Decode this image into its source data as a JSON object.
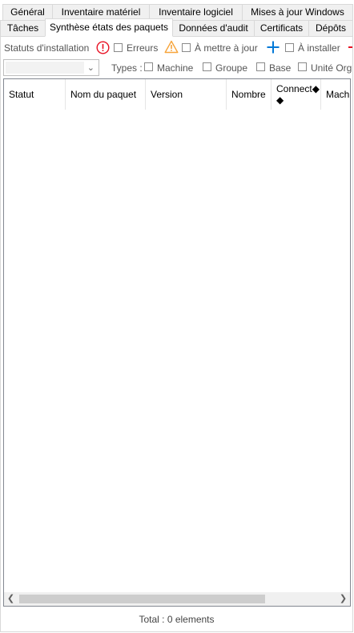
{
  "tabs_row1": [
    {
      "label": "Général"
    },
    {
      "label": "Inventaire matériel"
    },
    {
      "label": "Inventaire logiciel"
    },
    {
      "label": "Mises à jour Windows"
    }
  ],
  "tabs_row2": [
    {
      "label": "Tâches"
    },
    {
      "label": "Synthèse états des paquets",
      "active": true
    },
    {
      "label": "Données d'audit"
    },
    {
      "label": "Certificats"
    },
    {
      "label": "Dépôts"
    }
  ],
  "status_bar": {
    "label": "Statuts d'installation",
    "errors": "Erreurs",
    "to_update": "À mettre à jour",
    "to_install": "À installer"
  },
  "types_bar": {
    "combo_value": "",
    "label": "Types :",
    "machine": "Machine",
    "group": "Groupe",
    "base": "Base",
    "org_unit": "Unité Org"
  },
  "grid": {
    "columns": [
      "Statut",
      "Nom du paquet",
      "Version",
      "Nombre",
      "Connect◆\n◆",
      "Mach"
    ],
    "rows": []
  },
  "footer": {
    "total": "Total : 0 elements"
  },
  "colors": {
    "error": "#e81123",
    "warning": "#f7a53b",
    "add": "#0078d7"
  }
}
